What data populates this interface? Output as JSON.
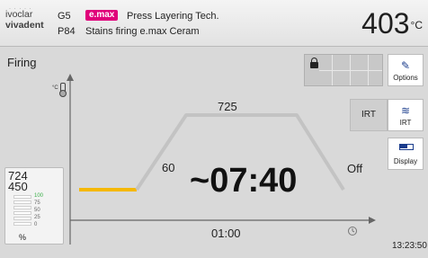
{
  "header": {
    "logo_line1": "ivoclar",
    "logo_line2": "vivadent",
    "logo_dots": "· · · · ·",
    "group": "G5",
    "brand_badge": "e.max",
    "title_line1": "Press Layering Tech.",
    "program": "P84",
    "title_line2": "Stains firing e.max Ceram",
    "temperature": "403",
    "temperature_unit": "°C"
  },
  "main": {
    "title": "Firing",
    "temp_unit": "°C",
    "graph": {
      "holding_temp": "725",
      "heating_rate": "60",
      "vacuum_off": "Off",
      "remaining_time": "~07:40",
      "hold_time": "01:00"
    },
    "clock": "13:23:50"
  },
  "gauge": {
    "value1": "724",
    "value2": "450",
    "ticks": [
      "100",
      "75",
      "50",
      "25",
      "0"
    ],
    "percent_label": "%"
  },
  "side_buttons": {
    "options": "Options",
    "irt_left": "IRT",
    "irt": "IRT",
    "display": "Display"
  },
  "colors": {
    "curve": "#c3c3c3",
    "start_segment": "#f5b800",
    "brand_badge": "#e0007a",
    "icon_blue": "#1a3c8c"
  },
  "icons": {
    "lock": "lock-icon",
    "options": "pencil-icon",
    "irt": "irt-icon",
    "display": "display-icon",
    "thermometer": "thermometer-icon",
    "clock": "clock-icon",
    "vacuum": "vacuum-icon"
  }
}
